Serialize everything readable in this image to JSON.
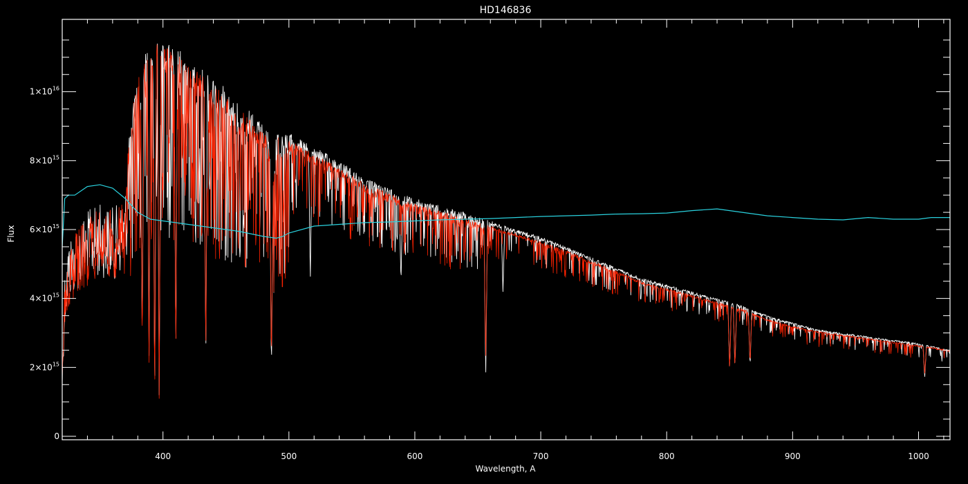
{
  "chart_data": {
    "type": "line",
    "title": "HD146836",
    "xlabel": "Wavelength, A",
    "ylabel": "Flux",
    "xlim": [
      320,
      1025
    ],
    "ylim": [
      -100000000000000.0,
      1.21e+16
    ],
    "x_ticks": [
      400,
      500,
      600,
      700,
      800,
      900,
      1000
    ],
    "x_tick_labels": [
      "400",
      "500",
      "600",
      "700",
      "800",
      "900",
      "1000"
    ],
    "y_ticks": [
      0,
      2000000000000000.0,
      4000000000000000.0,
      6000000000000000.0,
      8000000000000000.0,
      1e+16
    ],
    "y_tick_labels": [
      {
        "base": "0",
        "exp": ""
      },
      {
        "base": "2×10",
        "exp": "15"
      },
      {
        "base": "4×10",
        "exp": "15"
      },
      {
        "base": "6×10",
        "exp": "15"
      },
      {
        "base": "8×10",
        "exp": "15"
      },
      {
        "base": "1×10",
        "exp": "16"
      }
    ],
    "grid": false,
    "series": [
      {
        "color": "#ffffff",
        "envelope_x": [
          320,
          322,
          325,
          330,
          340,
          350,
          360,
          365,
          370,
          372,
          375,
          380,
          385,
          390,
          395,
          400,
          410,
          420,
          430,
          440,
          450,
          460,
          470,
          480,
          485,
          487,
          490,
          500,
          520,
          540,
          560,
          580,
          600,
          620,
          640,
          655,
          660,
          680,
          700,
          720,
          740,
          760,
          780,
          800,
          820,
          840,
          860,
          880,
          900,
          920,
          940,
          960,
          980,
          1000,
          1025
        ],
        "envelope_y": [
          2000000000000000.0,
          5000000000000000.0,
          6000000000000000.0,
          6400000000000000.0,
          6900000000000000.0,
          7100000000000000.0,
          7000000000000000.0,
          7100000000000000.0,
          7400000000000000.0,
          8500000000000000.0,
          9500000000000000.0,
          1.05e+16,
          1.13e+16,
          1.16e+16,
          1.17e+16,
          1.16e+16,
          1.13e+16,
          1.1e+16,
          1.07e+16,
          1.04e+16,
          1.01e+16,
          9700000000000000.0,
          9400000000000000.0,
          9000000000000000.0,
          8800000000000000.0,
          7500000000000000.0,
          8900000000000000.0,
          8800000000000000.0,
          8400000000000000.0,
          8000000000000000.0,
          7500000000000000.0,
          7200000000000000.0,
          6900000000000000.0,
          6700000000000000.0,
          6500000000000000.0,
          6300000000000000.0,
          6250000000000000.0,
          6000000000000000.0,
          5800000000000000.0,
          5500000000000000.0,
          5200000000000000.0,
          4900000000000000.0,
          4600000000000000.0,
          4400000000000000.0,
          4200000000000000.0,
          4000000000000000.0,
          3800000000000000.0,
          3500000000000000.0,
          3300000000000000.0,
          3100000000000000.0,
          3000000000000000.0,
          2900000000000000.0,
          2800000000000000.0,
          2700000000000000.0,
          2500000000000000.0
        ],
        "absorption_lines": [
          {
            "x": 383.5,
            "y": 2500000000000000.0
          },
          {
            "x": 388.9,
            "y": 2000000000000000.0
          },
          {
            "x": 393.4,
            "y": 1000000000000000.0
          },
          {
            "x": 397.0,
            "y": 1200000000000000.0
          },
          {
            "x": 410.2,
            "y": 2200000000000000.0
          },
          {
            "x": 434.0,
            "y": 2100000000000000.0
          },
          {
            "x": 486.1,
            "y": 1700000000000000.0
          },
          {
            "x": 517.0,
            "y": 4500000000000000.0
          },
          {
            "x": 589.0,
            "y": 4400000000000000.0
          },
          {
            "x": 656.3,
            "y": 1700000000000000.0
          },
          {
            "x": 670.0,
            "y": 4200000000000000.0
          },
          {
            "x": 850.0,
            "y": 1900000000000000.0
          },
          {
            "x": 854.2,
            "y": 2000000000000000.0
          },
          {
            "x": 866.2,
            "y": 2000000000000000.0
          },
          {
            "x": 1004.9,
            "y": 1700000000000000.0
          }
        ]
      },
      {
        "color": "#ff2200",
        "envelope_x": [
          320,
          322,
          325,
          330,
          340,
          350,
          360,
          365,
          370,
          372,
          375,
          380,
          385,
          390,
          395,
          400,
          410,
          420,
          430,
          440,
          450,
          460,
          470,
          480,
          485,
          487,
          490,
          500,
          520,
          540,
          560,
          580,
          600,
          620,
          640,
          655,
          660,
          680,
          700,
          720,
          740,
          760,
          780,
          800,
          820,
          840,
          860,
          880,
          900,
          920,
          940,
          960,
          980,
          1000,
          1025
        ],
        "envelope_y": [
          1800000000000000.0,
          4800000000000000.0,
          5800000000000000.0,
          6200000000000000.0,
          6700000000000000.0,
          7000000000000000.0,
          6900000000000000.0,
          7000000000000000.0,
          7200000000000000.0,
          8300000000000000.0,
          9300000000000000.0,
          1.03e+16,
          1.11e+16,
          1.14e+16,
          1.15e+16,
          1.14e+16,
          1.11e+16,
          1.08e+16,
          1.05e+16,
          1.02e+16,
          9900000000000000.0,
          9500000000000000.0,
          9200000000000000.0,
          8800000000000000.0,
          8600000000000000.0,
          7300000000000000.0,
          8700000000000000.0,
          8600000000000000.0,
          8200000000000000.0,
          7800000000000000.0,
          7350000000000000.0,
          7050000000000000.0,
          6750000000000000.0,
          6550000000000000.0,
          6350000000000000.0,
          6200000000000000.0,
          6100000000000000.0,
          5900000000000000.0,
          5650000000000000.0,
          5400000000000000.0,
          5100000000000000.0,
          4800000000000000.0,
          4500000000000000.0,
          4300000000000000.0,
          4100000000000000.0,
          3900000000000000.0,
          3700000000000000.0,
          3400000000000000.0,
          3200000000000000.0,
          3050000000000000.0,
          2950000000000000.0,
          2850000000000000.0,
          2750000000000000.0,
          2650000000000000.0,
          2500000000000000.0
        ],
        "absorption_lines": [
          {
            "x": 383.5,
            "y": 2300000000000000.0
          },
          {
            "x": 388.9,
            "y": 1800000000000000.0
          },
          {
            "x": 393.4,
            "y": 900000000000000.0
          },
          {
            "x": 397.0,
            "y": 1100000000000000.0
          },
          {
            "x": 410.2,
            "y": 2200000000000000.0
          },
          {
            "x": 434.0,
            "y": 2200000000000000.0
          },
          {
            "x": 486.1,
            "y": 2000000000000000.0
          },
          {
            "x": 656.3,
            "y": 2200000000000000.0
          },
          {
            "x": 850.0,
            "y": 1900000000000000.0
          },
          {
            "x": 854.2,
            "y": 2000000000000000.0
          },
          {
            "x": 866.2,
            "y": 2100000000000000.0
          },
          {
            "x": 1004.9,
            "y": 1800000000000000.0
          }
        ]
      },
      {
        "color": "#2ad3e0",
        "x": [
          320,
          322,
          325,
          330,
          340,
          350,
          360,
          370,
          380,
          390,
          400,
          420,
          440,
          460,
          480,
          490,
          495,
          500,
          520,
          540,
          560,
          580,
          600,
          620,
          640,
          660,
          680,
          700,
          720,
          740,
          760,
          780,
          800,
          820,
          840,
          860,
          880,
          900,
          920,
          940,
          960,
          980,
          1000,
          1010,
          1025
        ],
        "y": [
          5500000000000000.0,
          6900000000000000.0,
          7000000000000000.0,
          7000000000000000.0,
          7250000000000000.0,
          7300000000000000.0,
          7200000000000000.0,
          6900000000000000.0,
          6500000000000000.0,
          6300000000000000.0,
          6250000000000000.0,
          6150000000000000.0,
          6050000000000000.0,
          5950000000000000.0,
          5800000000000000.0,
          5750000000000000.0,
          5800000000000000.0,
          5900000000000000.0,
          6100000000000000.0,
          6150000000000000.0,
          6200000000000000.0,
          6220000000000000.0,
          6250000000000000.0,
          6280000000000000.0,
          6300000000000000.0,
          6320000000000000.0,
          6350000000000000.0,
          6380000000000000.0,
          6400000000000000.0,
          6420000000000000.0,
          6450000000000000.0,
          6460000000000000.0,
          6480000000000000.0,
          6550000000000000.0,
          6600000000000000.0,
          6500000000000000.0,
          6400000000000000.0,
          6350000000000000.0,
          6300000000000000.0,
          6280000000000000.0,
          6350000000000000.0,
          6300000000000000.0,
          6300000000000000.0,
          6350000000000000.0,
          6350000000000000.0
        ]
      }
    ]
  }
}
